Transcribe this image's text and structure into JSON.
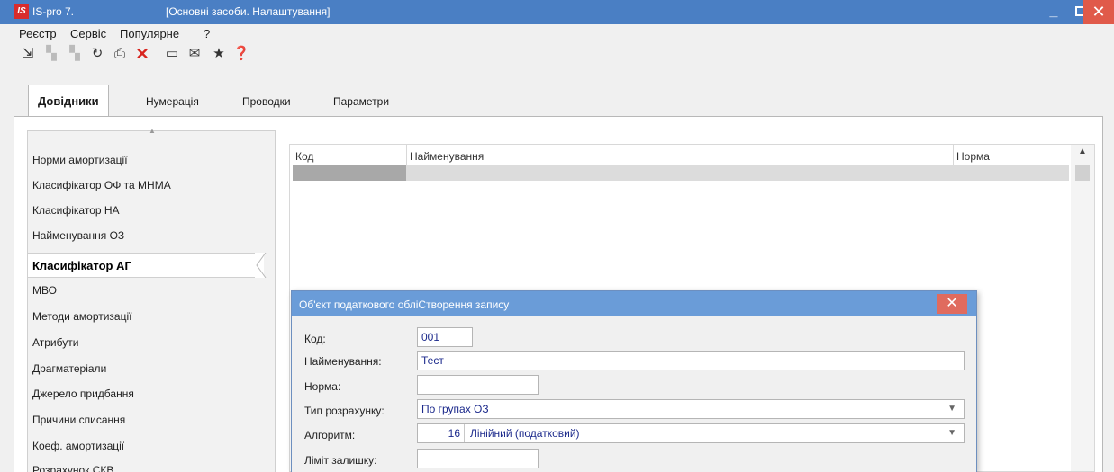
{
  "window": {
    "app_name": "IS-pro 7.",
    "doc_title": "[Основні засоби. Налаштування]",
    "logo_text": "IS",
    "min_glyph": "_",
    "close_glyph": "✕"
  },
  "menu": [
    "Реєстр",
    "Сервіс",
    "Популярне",
    "?"
  ],
  "toolbar_icons": [
    {
      "name": "new-record-icon",
      "glyph": "⇲"
    },
    {
      "name": "edit-record-icon",
      "glyph": "▚"
    },
    {
      "name": "copy-record-icon",
      "glyph": "▚"
    },
    {
      "name": "refresh-icon",
      "glyph": "↻"
    },
    {
      "name": "print-icon",
      "glyph": "⎙"
    },
    {
      "name": "delete-icon",
      "glyph": "✕"
    },
    {
      "name": "form-icon",
      "glyph": "▭"
    },
    {
      "name": "mail-icon",
      "glyph": "✉"
    },
    {
      "name": "star-icon",
      "glyph": "★"
    },
    {
      "name": "help-icon",
      "glyph": "❓"
    }
  ],
  "tabs": [
    "Довідники",
    "Нумерація",
    "Проводки",
    "Параметри"
  ],
  "sidebar": {
    "scroll_up_glyph": "▲",
    "items": [
      "Норми амортизації",
      "Класифікатор ОФ та МНМА",
      "Класифікатор НА",
      "Найменування ОЗ",
      "Класифікатор АГ",
      "МВО",
      "Методи амортизації",
      "Атрибути",
      "Драгматеріали",
      "Джерело придбання",
      "Причини списання",
      "Коеф. амортизації",
      "Розрахунок СКВ"
    ],
    "active_index": 4
  },
  "grid": {
    "columns": [
      "Код",
      "Найменування",
      "Норма"
    ],
    "scroll_up_glyph": "▲"
  },
  "dialog": {
    "title": "Об'єкт податкового обліСтворення запису",
    "close_glyph": "✕",
    "fields": {
      "code_label": "Код:",
      "code_value": "001",
      "name_label": "Найменування:",
      "name_value": "Тест",
      "norm_label": "Норма:",
      "norm_value": "",
      "calc_type_label": "Тип розрахунку:",
      "calc_type_value": "По групах ОЗ",
      "algorithm_label": "Алгоритм:",
      "algorithm_code": "16",
      "algorithm_value": "Лінійний (податковий)",
      "limit_label": "Ліміт залишку:",
      "limit_value": ""
    },
    "dropdown_glyph": "▼"
  }
}
